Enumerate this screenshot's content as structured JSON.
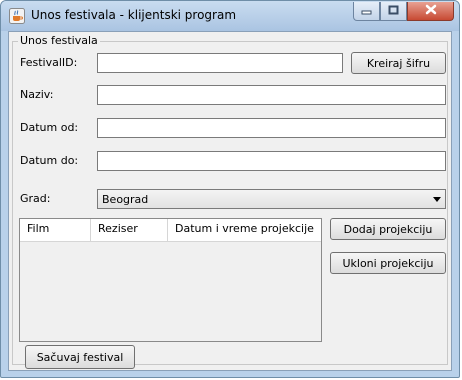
{
  "window": {
    "title": "Unos festivala - klijentski program"
  },
  "icons": {
    "app": "java-cup-icon",
    "minimize": "minimize-icon",
    "maximize": "maximize-icon",
    "close": "close-icon",
    "dropdown": "chevron-down-icon"
  },
  "form": {
    "group_title": "Unos festivala",
    "festival_id": {
      "label": "FestivalID:",
      "value": ""
    },
    "create_code_button": "Kreiraj šifru",
    "name": {
      "label": "Naziv:",
      "value": ""
    },
    "date_from": {
      "label": "Datum od:",
      "value": ""
    },
    "date_to": {
      "label": "Datum do:",
      "value": ""
    },
    "city": {
      "label": "Grad:",
      "selected": "Beograd"
    }
  },
  "table": {
    "columns": [
      "Film",
      "Reziser",
      "Datum i vreme projekcije"
    ],
    "rows": []
  },
  "buttons": {
    "add_projection": "Dodaj projekciju",
    "remove_projection": "Ukloni projekciju",
    "save_festival": "Sačuvaj festival"
  },
  "colors": {
    "title_bar": "#b9d1ea",
    "close_button": "#c74a33",
    "panel_bg": "#f0f0f0"
  }
}
